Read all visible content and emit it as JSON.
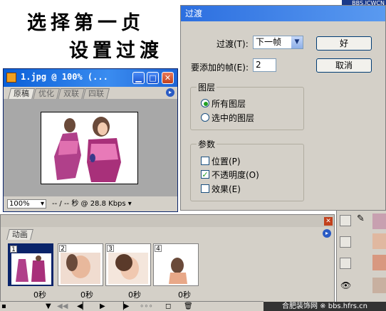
{
  "instructions": {
    "step1": "选择第一贞",
    "step2": "设置过渡"
  },
  "watermark_top": "BBS.JCWCN",
  "image_window": {
    "title": "1.jpg @ 100% (...",
    "tabs": [
      "原稿",
      "优化",
      "双联",
      "四联"
    ],
    "zoom": "100%",
    "status": "-- / -- 秒 @ 28.8 Kbps"
  },
  "dialog": {
    "title": "过渡",
    "tween_label": "过渡(T):",
    "tween_value": "下一帧",
    "frames_label": "要添加的帧(E):",
    "frames_value": "2",
    "ok_label": "好",
    "cancel_label": "取消",
    "layers_group": "图层",
    "all_layers": "所有图层",
    "selected_layer": "选中的图层",
    "params_group": "参数",
    "position": "位置(P)",
    "opacity": "不透明度(O)",
    "effects": "效果(E)"
  },
  "animation": {
    "tab": "动画",
    "frames": [
      {
        "num": "1",
        "delay": "0秒"
      },
      {
        "num": "2",
        "delay": "0秒"
      },
      {
        "num": "3",
        "delay": "0秒"
      },
      {
        "num": "4",
        "delay": "0秒"
      }
    ]
  },
  "watermark_bottom": "合肥装饰网 ※ bbs.hfrs.cn",
  "colors": {
    "title_blue": "#0a5fd8",
    "accent_green": "#21a121",
    "bg_gray": "#d4d0c8"
  }
}
